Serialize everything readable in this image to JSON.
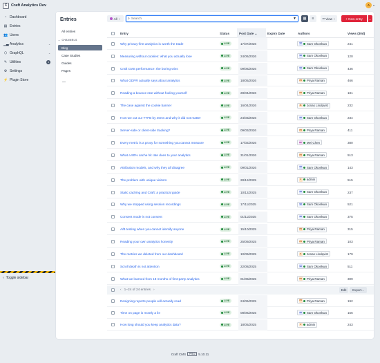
{
  "header": {
    "site_logo_letter": "C",
    "site_name": "Craft Analytics Dev",
    "user_initial": "A"
  },
  "sidebar": {
    "items": [
      {
        "label": "Dashboard",
        "icon": "gauge-icon"
      },
      {
        "label": "Entries",
        "icon": "newspaper-icon"
      },
      {
        "label": "Users",
        "icon": "users-icon"
      },
      {
        "label": "Analytics",
        "icon": "chart-icon"
      },
      {
        "label": "GraphQL",
        "icon": "graphql-icon"
      },
      {
        "label": "Utilities",
        "icon": "wrench-icon",
        "badge": "1"
      },
      {
        "label": "Settings",
        "icon": "gear-icon"
      },
      {
        "label": "Plugin Store",
        "icon": "plug-icon"
      }
    ],
    "toggle_label": "Toggle sidebar"
  },
  "main": {
    "title": "Entries",
    "sources": {
      "all": "All entries",
      "channels_heading": "CHANNELS",
      "channels": [
        "Blog",
        "Case Studies",
        "Guides",
        "Pages"
      ],
      "selected": "Blog",
      "separator": "—"
    },
    "toolbar": {
      "site_filter": "All",
      "search_placeholder": "Search",
      "view_label": "View",
      "new_entry_label": "+ New entry"
    },
    "table": {
      "columns": [
        "Entry",
        "Status",
        "Post Date",
        "Expiry Date",
        "Authors",
        "Views (30d)"
      ],
      "sorted_column": "Post Date",
      "rows": [
        {
          "title": "Why privacy-first analytics is worth the trade",
          "status": "LIVE",
          "date": "17/07/2026",
          "author": "Sam Okonkwo",
          "views": "241"
        },
        {
          "title": "Measuring without cookies: what you actually lose",
          "status": "LIVE",
          "date": "24/06/2026",
          "author": "Sam Okonkwo",
          "views": "120"
        },
        {
          "title": "Craft CMS performance: the boring wins",
          "status": "LIVE",
          "date": "09/06/2026",
          "author": "Sam Okonkwo",
          "views": "436"
        },
        {
          "title": "What GDPR actually says about analytics",
          "status": "LIVE",
          "date": "18/05/2026",
          "author": "Priya Raman",
          "views": "466"
        },
        {
          "title": "Reading a bounce rate without fooling yourself",
          "status": "LIVE",
          "date": "28/04/2026",
          "author": "Priya Raman",
          "views": "181"
        },
        {
          "title": "The case against the cookie banner",
          "status": "LIVE",
          "date": "16/04/2026",
          "author": "Jonas Lindqvist",
          "views": "232"
        },
        {
          "title": "How we cut our TTFB by 40ms and why it did not matter",
          "status": "LIVE",
          "date": "24/03/2026",
          "author": "Sam Okonkwo",
          "views": "234"
        },
        {
          "title": "Server-side or client-side tracking?",
          "status": "LIVE",
          "date": "09/03/2026",
          "author": "Priya Raman",
          "views": "411"
        },
        {
          "title": "Every metric is a proxy for something you cannot measure",
          "status": "LIVE",
          "date": "17/02/2026",
          "author": "Mei Chen",
          "views": "380"
        },
        {
          "title": "What a 90% cache hit rate does to your analytics",
          "status": "LIVE",
          "date": "31/01/2026",
          "author": "Priya Raman",
          "views": "513"
        },
        {
          "title": "Attribution models, and why they all disagree",
          "status": "LIVE",
          "date": "09/01/2026",
          "author": "Sam Okonkwo",
          "views": "143"
        },
        {
          "title": "The problem with unique visitors",
          "status": "LIVE",
          "date": "28/12/2025",
          "author": "admin",
          "views": "515"
        },
        {
          "title": "Static caching and Craft: a practical guide",
          "status": "LIVE",
          "date": "10/12/2025",
          "author": "Sam Okonkwo",
          "views": "237"
        },
        {
          "title": "Why we stopped using session recordings",
          "status": "LIVE",
          "date": "17/11/2025",
          "author": "Sam Okonkwo",
          "views": "521"
        },
        {
          "title": "Consent mode is not consent",
          "status": "LIVE",
          "date": "01/11/2025",
          "author": "Sam Okonkwo",
          "views": "375"
        },
        {
          "title": "A/B testing when you cannot identify anyone",
          "status": "LIVE",
          "date": "15/10/2025",
          "author": "Priya Raman",
          "views": "315"
        },
        {
          "title": "Reading your own analytics honestly",
          "status": "LIVE",
          "date": "25/09/2025",
          "author": "Priya Raman",
          "views": "103"
        },
        {
          "title": "The metrics we deleted from our dashboard",
          "status": "LIVE",
          "date": "10/09/2025",
          "author": "Jonas Lindqvist",
          "views": "179"
        },
        {
          "title": "Scroll depth is not attention",
          "status": "LIVE",
          "date": "22/08/2025",
          "author": "Sam Okonkwo",
          "views": "511"
        },
        {
          "title": "What we learned from 18 months of first-party analytics",
          "status": "LIVE",
          "date": "01/08/2025",
          "author": "Priya Raman",
          "views": "309"
        }
      ],
      "pager": "1–24 of 24 entries",
      "edit_label": "Edit",
      "export_label": "Export...",
      "extra_rows": [
        {
          "title": "Designing reports people will actually read",
          "status": "LIVE",
          "date": "24/06/2025",
          "author": "Priya Raman",
          "views": "192"
        },
        {
          "title": "Time on page is mostly a lie",
          "status": "LIVE",
          "date": "08/06/2025",
          "author": "Sam Okonkwo",
          "views": "156"
        },
        {
          "title": "How long should you keep analytics data?",
          "status": "LIVE",
          "date": "18/05/2025",
          "author": "admin",
          "views": "243"
        }
      ]
    }
  },
  "authors": {
    "Sam Okonkwo": {
      "initials": "SO",
      "bg": "#dbe4ff",
      "fg": "#3b4fb8"
    },
    "Priya Raman": {
      "initials": "PR",
      "bg": "#fde2c4",
      "fg": "#b4530f"
    },
    "Jonas Lindqvist": {
      "initials": "JL",
      "bg": "#fde2c4",
      "fg": "#b4530f"
    },
    "Mei Chen": {
      "initials": "MC",
      "bg": "#f3d5f3",
      "fg": "#9a2f9a"
    },
    "admin": {
      "initials": "A",
      "bg": "#fde2c4",
      "fg": "#b4530f"
    }
  },
  "colors": {
    "accent": "#e0243a",
    "link": "#2563eb",
    "live": "#1f8a3b"
  },
  "footer": {
    "app": "Craft CMS",
    "edition": "PRO",
    "version": "5.10.11"
  }
}
